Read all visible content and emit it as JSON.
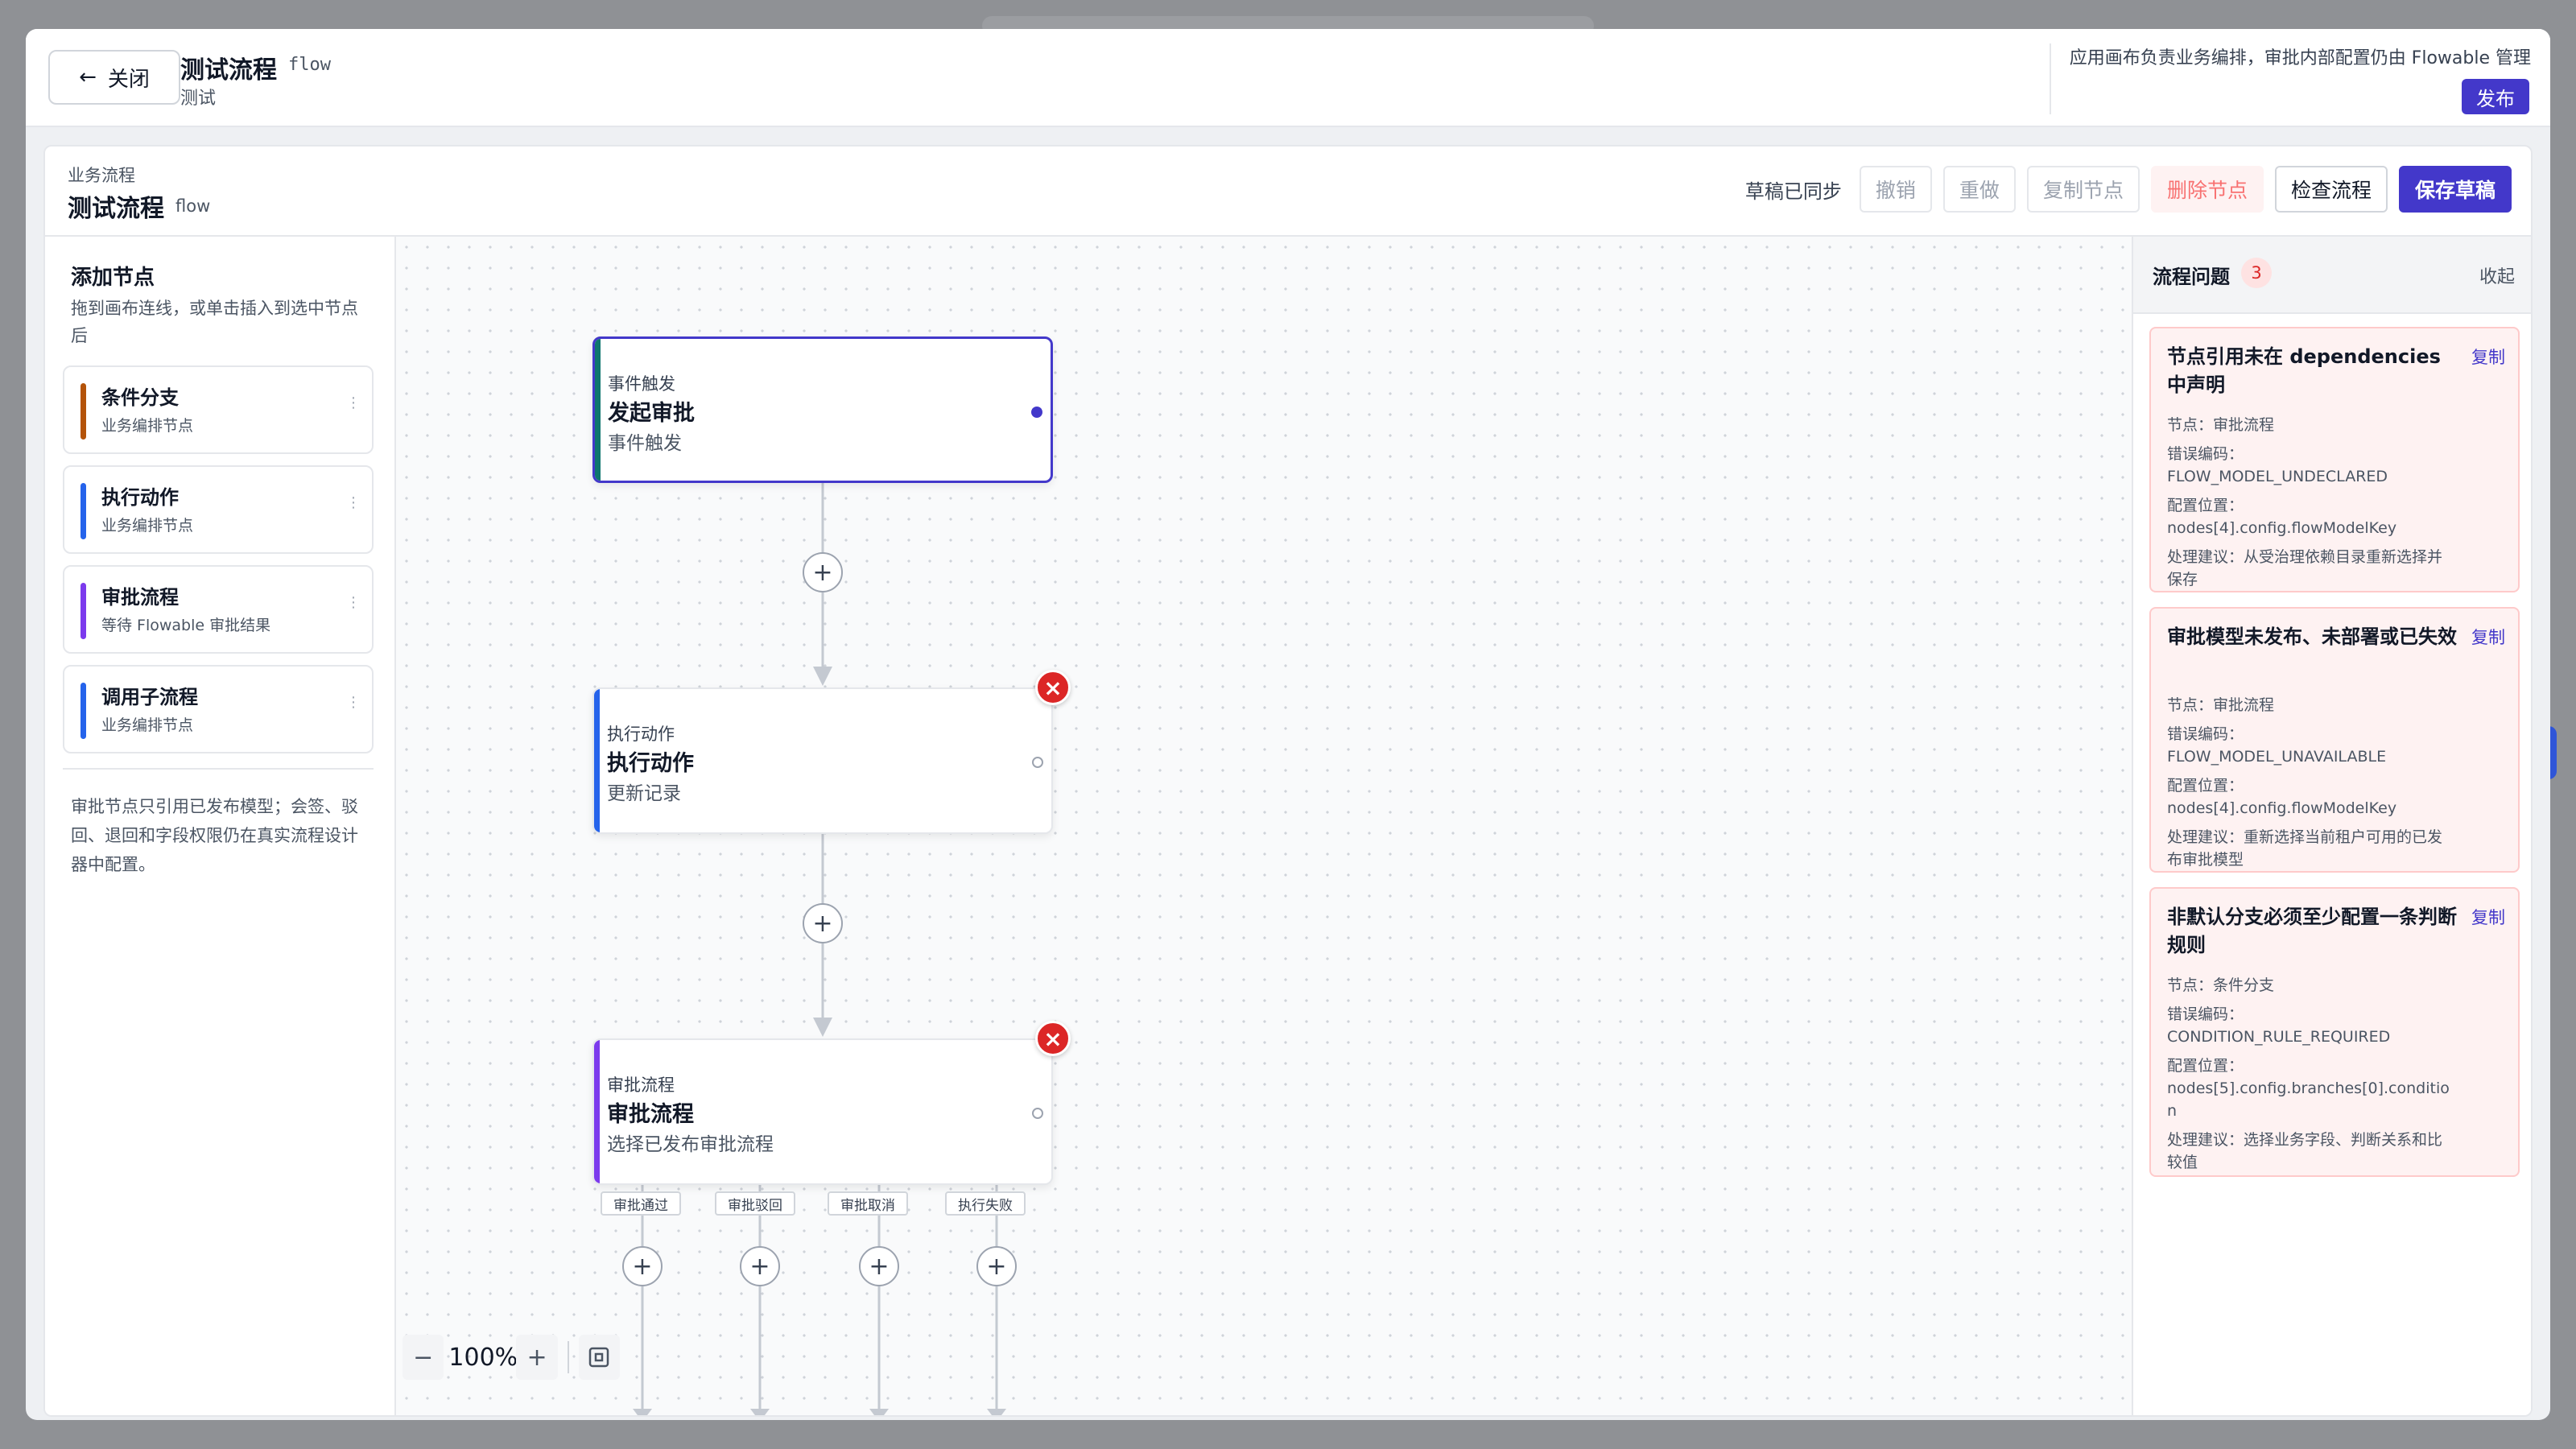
{
  "modal": {
    "close_label": "关闭",
    "title": "测试流程",
    "code": "flow",
    "subtitle": "测试",
    "note": "应用画布负责业务编排，审批内部配置仍由 Flowable 管理",
    "publish_label": "发布"
  },
  "editor": {
    "breadcrumb": "业务流程",
    "title": "测试流程",
    "code": "flow",
    "sync_status": "草稿已同步",
    "toolbar": {
      "undo": "撤销",
      "redo": "重做",
      "copy_node": "复制节点",
      "delete_node": "删除节点",
      "check_flow": "检查流程",
      "save_draft": "保存草稿"
    }
  },
  "sidebar": {
    "title": "添加节点",
    "description": "拖到画布连线，或单击插入到选中节点后",
    "items": [
      {
        "name": "条件分支",
        "sub": "业务编排节点",
        "color": "#b45309"
      },
      {
        "name": "执行动作",
        "sub": "业务编排节点",
        "color": "#2563eb"
      },
      {
        "name": "审批流程",
        "sub": "等待 Flowable 审批结果",
        "color": "#7c3aed"
      },
      {
        "name": "调用子流程",
        "sub": "业务编排节点",
        "color": "#2563eb"
      }
    ],
    "note": "审批节点只引用已发布模型；会签、驳回、退回和字段权限仍在真实流程设计器中配置。"
  },
  "canvas": {
    "nodes": [
      {
        "type": "事件触发",
        "title": "发起审批",
        "sub": "事件触发",
        "color": "#0f766e"
      },
      {
        "type": "执行动作",
        "title": "执行动作",
        "sub": "更新记录",
        "color": "#2563eb"
      },
      {
        "type": "审批流程",
        "title": "审批流程",
        "sub": "选择已发布审批流程",
        "color": "#7c3aed"
      }
    ],
    "branches": [
      "审批通过",
      "审批驳回",
      "审批取消",
      "执行失败"
    ],
    "error_symbol": "×",
    "plus_symbol": "+",
    "zoom": {
      "out": "−",
      "level": "100%",
      "in": "+"
    }
  },
  "issues": {
    "title": "流程问题",
    "count": "3",
    "collapse": "收起",
    "copy_label": "复制",
    "items": [
      {
        "title": "节点引用未在 dependencies 中声明",
        "node": "节点：审批流程",
        "code_label": "错误编码：",
        "code": "FLOW_MODEL_UNDECLARED",
        "path_label": "配置位置：",
        "path": "nodes[4].config.flowModelKey",
        "suggestion": "处理建议：从受治理依赖目录重新选择并保存"
      },
      {
        "title": "审批模型未发布、未部署或已失效",
        "node": "节点：审批流程",
        "code_label": "错误编码：",
        "code": "FLOW_MODEL_UNAVAILABLE",
        "path_label": "配置位置：",
        "path": "nodes[4].config.flowModelKey",
        "suggestion": "处理建议：重新选择当前租户可用的已发布审批模型"
      },
      {
        "title": "非默认分支必须至少配置一条判断规则",
        "node": "节点：条件分支",
        "code_label": "错误编码：",
        "code": "CONDITION_RULE_REQUIRED",
        "path_label": "配置位置：",
        "path": "nodes[5].config.branches[0].condition",
        "suggestion": "处理建议：选择业务字段、判断关系和比较值"
      }
    ]
  }
}
